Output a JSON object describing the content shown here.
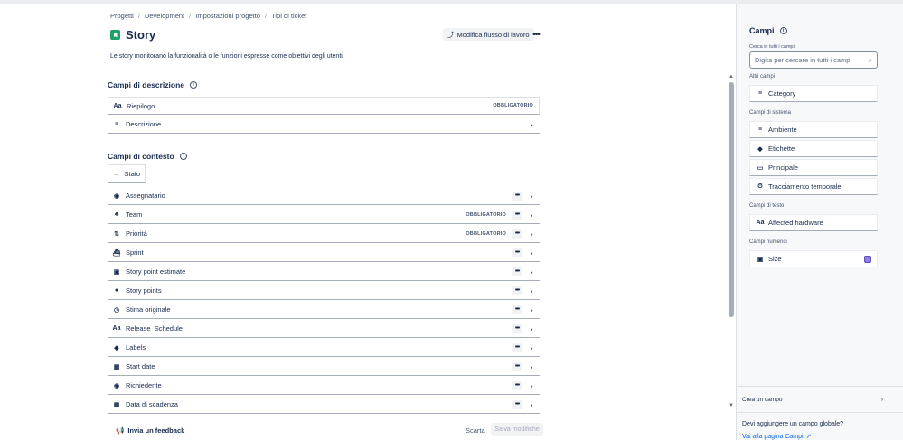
{
  "breadcrumb": [
    "Progetti",
    "Development",
    "Impostazioni progetto",
    "Tipi di ticket"
  ],
  "page": {
    "title": "Story",
    "description": "Le story monitorano la funzionalità o le funzioni espresse come obiettivi degli utenti.",
    "workflow_button": "Modifica flusso di lavoro"
  },
  "description_section": {
    "title": "Campi di descrizione",
    "fields": [
      {
        "label": "Riepilogo",
        "icon": "text-icon",
        "badge": "OBBLIGATORIO"
      },
      {
        "label": "Descrizione",
        "icon": "paragraph-icon",
        "badge": ""
      }
    ]
  },
  "context_section": {
    "title": "Campi di contesto",
    "stato": "Stato",
    "fields": [
      {
        "label": "Assegnatario",
        "icon": "user-icon",
        "badge": ""
      },
      {
        "label": "Team",
        "icon": "team-icon",
        "badge": "OBBLIGATORIO"
      },
      {
        "label": "Priorità",
        "icon": "priority-icon",
        "badge": "OBBLIGATORIO"
      },
      {
        "label": "Sprint",
        "icon": "sprint-icon",
        "badge": ""
      },
      {
        "label": "Story point estimate",
        "icon": "number-icon",
        "badge": ""
      },
      {
        "label": "Story points",
        "icon": "check-circle-icon",
        "badge": ""
      },
      {
        "label": "Stima originale",
        "icon": "clock-icon",
        "badge": ""
      },
      {
        "label": "Release_Schedule",
        "icon": "text-icon",
        "badge": ""
      },
      {
        "label": "Labels",
        "icon": "tag-icon",
        "badge": ""
      },
      {
        "label": "Start date",
        "icon": "calendar-icon",
        "badge": ""
      },
      {
        "label": "Richiedente",
        "icon": "user-icon",
        "badge": ""
      },
      {
        "label": "Data di scadenza",
        "icon": "calendar-icon",
        "badge": ""
      }
    ]
  },
  "footer": {
    "feedback": "Invia un feedback",
    "discard": "Scarta",
    "save": "Salva modifiche"
  },
  "panel": {
    "title": "Campi",
    "search_label": "Cerca in tutti i campi",
    "search_placeholder": "Digita per cercare in tutti i campi",
    "groups": {
      "other": {
        "label": "Altri campi",
        "fields": [
          "Category"
        ]
      },
      "system": {
        "label": "Campi di sistema",
        "fields": [
          "Ambiente",
          "Etichette",
          "Principale",
          "Tracciamento temporale"
        ]
      },
      "text": {
        "label": "Campi di testo",
        "fields": [
          "Affected hardware"
        ]
      },
      "numeric": {
        "label": "Campi numerici",
        "fields": [
          "Size"
        ]
      }
    },
    "create_field": "Crea un campo",
    "global_question": "Devi aggiungere un campo globale?",
    "global_link": "Vai alla pagina Campi"
  }
}
